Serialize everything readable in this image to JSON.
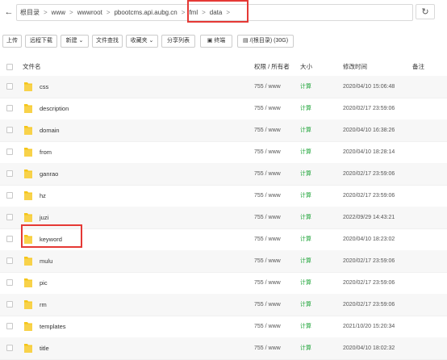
{
  "pathbar": {
    "crumbs": [
      "根目录",
      "www",
      "wwwroot",
      "pbootcms.api.aubg.cn",
      "fml",
      "data"
    ],
    "separator": ">"
  },
  "toolbar": {
    "upload": "上传",
    "remote_download": "远程下载",
    "new": "新建",
    "file_search": "文件查找",
    "favorites": "收藏夹",
    "share_list": "分享列表",
    "terminal": "终端",
    "disk": "/(根目录) (30G)"
  },
  "table": {
    "headers": {
      "name": "文件名",
      "perm": "权限 / 所有者",
      "size": "大小",
      "mtime": "修改时间",
      "note": "备注"
    },
    "rows": [
      {
        "name": "css",
        "perm": "755 / www",
        "size": "计算",
        "mtime": "2020/04/10 15:06:48"
      },
      {
        "name": "description",
        "perm": "755 / www",
        "size": "计算",
        "mtime": "2020/02/17 23:59:06"
      },
      {
        "name": "domain",
        "perm": "755 / www",
        "size": "计算",
        "mtime": "2020/04/10 16:38:26"
      },
      {
        "name": "from",
        "perm": "755 / www",
        "size": "计算",
        "mtime": "2020/04/10 18:28:14"
      },
      {
        "name": "ganrao",
        "perm": "755 / www",
        "size": "计算",
        "mtime": "2020/02/17 23:59:06"
      },
      {
        "name": "hz",
        "perm": "755 / www",
        "size": "计算",
        "mtime": "2020/02/17 23:59:06"
      },
      {
        "name": "juzi",
        "perm": "755 / www",
        "size": "计算",
        "mtime": "2022/09/29 14:43:21"
      },
      {
        "name": "keyword",
        "perm": "755 / www",
        "size": "计算",
        "mtime": "2020/04/10 18:23:02"
      },
      {
        "name": "mulu",
        "perm": "755 / www",
        "size": "计算",
        "mtime": "2020/02/17 23:59:06"
      },
      {
        "name": "pic",
        "perm": "755 / www",
        "size": "计算",
        "mtime": "2020/02/17 23:59:06"
      },
      {
        "name": "rm",
        "perm": "755 / www",
        "size": "计算",
        "mtime": "2020/02/17 23:59:06"
      },
      {
        "name": "templates",
        "perm": "755 / www",
        "size": "计算",
        "mtime": "2021/10/20 15:20:34"
      },
      {
        "name": "title",
        "perm": "755 / www",
        "size": "计算",
        "mtime": "2020/04/10 18:02:32"
      }
    ]
  },
  "colors": {
    "folder": "#f5c518",
    "size_link": "#20a53a",
    "highlight": "#e53935"
  }
}
